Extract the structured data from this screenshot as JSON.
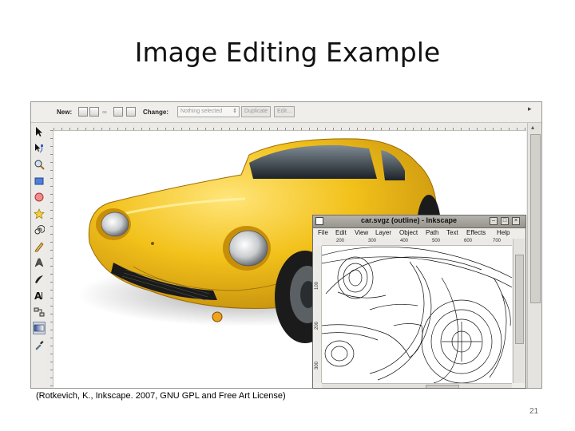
{
  "slide": {
    "title": "Image Editing Example",
    "caption": "(Rotkevich, K., Inkscape. 2007, GNU GPL and Free Art License)",
    "page_number": "21"
  },
  "inkscape_main": {
    "toolbar": {
      "new_label": "New:",
      "change_label": "Change:",
      "combo_value": "Nothing selected",
      "duplicate_label": "Duplicate",
      "edit_label": "Edit..."
    },
    "tools": [
      "select-arrow-icon",
      "node-edit-icon",
      "zoom-icon",
      "rectangle-icon",
      "ellipse-icon",
      "star-icon",
      "spiral-icon",
      "pencil-icon",
      "pen-icon",
      "calligraphy-icon",
      "text-icon",
      "connector-icon",
      "gradient-icon",
      "dropper-icon"
    ]
  },
  "sub_window": {
    "title": "car.svgz (outline) - Inkscape",
    "menu": [
      "File",
      "Edit",
      "View",
      "Layer",
      "Object",
      "Path",
      "Text",
      "Effects",
      "Help"
    ],
    "ruler_labels": [
      "200",
      "300",
      "400",
      "500",
      "600",
      "700"
    ],
    "v_ruler_labels": [
      "100",
      "200",
      "300"
    ]
  },
  "colors": {
    "car_body": "#f2c11a",
    "car_body_dark": "#c48c06",
    "window_bg": "#ecebe8",
    "titlebar": "#a8a59e"
  }
}
